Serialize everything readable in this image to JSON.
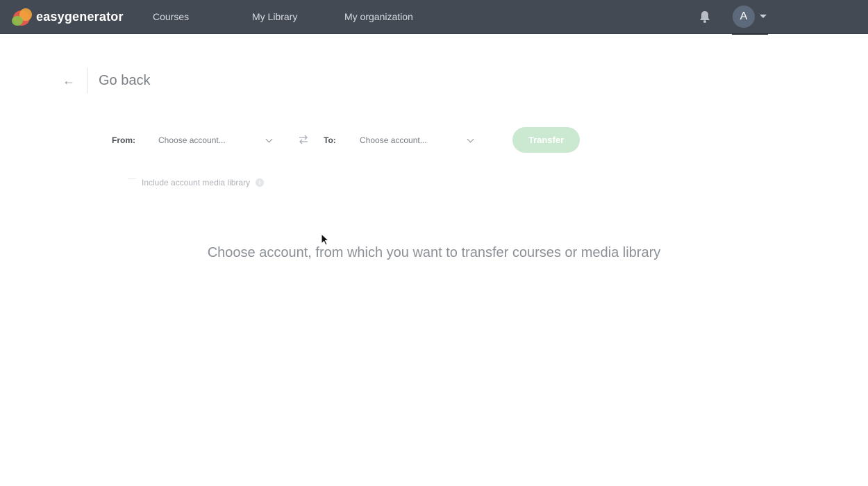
{
  "app": {
    "logo_text": "easygenerator"
  },
  "nav": {
    "items": [
      {
        "label": "Courses"
      },
      {
        "label": "My Library"
      },
      {
        "label": "My organization"
      }
    ]
  },
  "user": {
    "avatar_initial": "A"
  },
  "page": {
    "back_label": "Go back",
    "from_label": "From:",
    "from_select_value": "Choose account...",
    "to_label": "To:",
    "to_select_value": "Choose account...",
    "transfer_button": "Transfer",
    "include_media_label": "Include account media library",
    "info_icon_glyph": "i",
    "hint": "Choose account, from which you want to transfer courses or media library"
  },
  "colors": {
    "topbar": "#434a54",
    "transfer_disabled": "#cbe8d0",
    "avatar": "#5c6a7c"
  },
  "icons": [
    "bell-icon",
    "chevron-down-icon",
    "swap-arrows-icon",
    "back-arrow-icon",
    "info-icon"
  ]
}
